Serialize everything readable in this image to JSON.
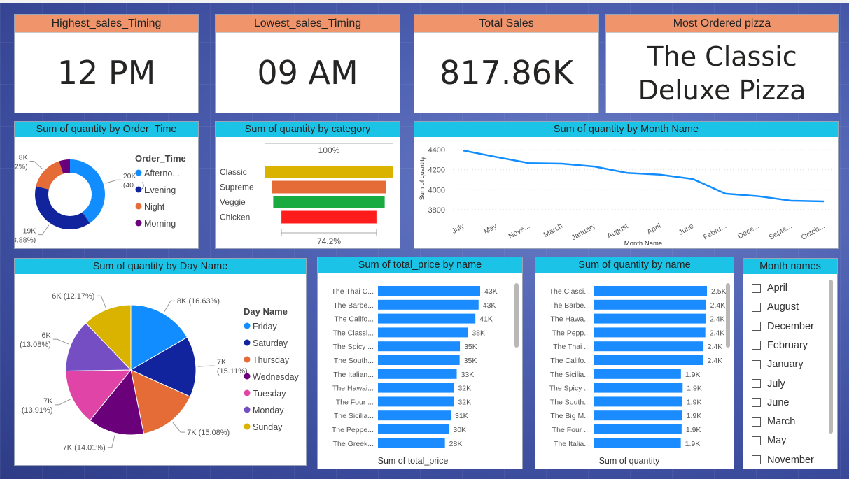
{
  "kpis": [
    {
      "title": "Highest_sales_Timing",
      "value": "12 PM"
    },
    {
      "title": "Lowest_sales_Timing",
      "value": "09 AM"
    },
    {
      "title": "Total Sales",
      "value": "817.86K"
    },
    {
      "title": "Most Ordered pizza",
      "value_line1": "The Classic",
      "value_line2": "Deluxe Pizza"
    }
  ],
  "colors": {
    "card_header": "#f0956b",
    "visual_header": "#1bc3e6",
    "bar_blue": "#1a8cff"
  },
  "chart_data": [
    {
      "type": "pie",
      "id": "order_time",
      "title": "Sum of quantity by Order_Time",
      "donut": true,
      "legend_title": "Order_Time",
      "legend_labels": [
        "Afterno...",
        "Evening",
        "Night",
        "Morning"
      ],
      "labels": [
        "Afternoon",
        "Evening",
        "Night",
        "Morning"
      ],
      "values": [
        20000,
        19000,
        8000,
        2500
      ],
      "colors": [
        "#118dff",
        "#12239e",
        "#e66c37",
        "#6b007b"
      ],
      "data_labels": [
        {
          "l1": "20K",
          "l2": "(40....)"
        },
        {
          "l1": "19K",
          "l2": "(38.88%)"
        },
        {
          "l1": "8K",
          "l2": "(15.2%)"
        },
        {
          "l1": "",
          "l2": ""
        }
      ],
      "legend_position": "right"
    },
    {
      "type": "funnel",
      "id": "category",
      "title": "Sum of quantity by category",
      "categories": [
        "Classic",
        "Supreme",
        "Veggie",
        "Chicken"
      ],
      "values": [
        100,
        89,
        87,
        74.2
      ],
      "colors": [
        "#d9b300",
        "#e66c37",
        "#1aab40",
        "#ff1c1c"
      ],
      "top_label": "100%",
      "bottom_label": "74.2%"
    },
    {
      "type": "line",
      "id": "month",
      "title": "Sum of quantity by Month Name",
      "categories": [
        "July",
        "May",
        "Nove...",
        "March",
        "January",
        "August",
        "April",
        "June",
        "Febru...",
        "Dece...",
        "Septe...",
        "Octob..."
      ],
      "values": [
        4392,
        4328,
        4266,
        4261,
        4232,
        4168,
        4151,
        4107,
        3961,
        3935,
        3890,
        3883
      ],
      "xlabel": "Month Name",
      "ylabel": "Sum of quantity",
      "yticks": [
        3800,
        4000,
        4200,
        4400
      ],
      "ylim": [
        3750,
        4450
      ],
      "grid": true,
      "color": "#118dff"
    },
    {
      "type": "pie",
      "id": "day",
      "title": "Sum of quantity by Day Name",
      "donut": false,
      "legend_title": "Day Name",
      "legend_labels": [
        "Friday",
        "Saturday",
        "Thursday",
        "Wednesday",
        "Tuesday",
        "Monday",
        "Sunday"
      ],
      "labels": [
        "Friday",
        "Saturday",
        "Thursday",
        "Wednesday",
        "Tuesday",
        "Monday",
        "Sunday"
      ],
      "values": [
        16.63,
        15.11,
        15.08,
        14.01,
        13.91,
        13.08,
        12.17
      ],
      "colors": [
        "#118dff",
        "#12239e",
        "#e66c37",
        "#6b007b",
        "#e044a7",
        "#744ec2",
        "#d9b300"
      ],
      "data_labels": [
        {
          "l1": "8K (16.63%)",
          "l2": ""
        },
        {
          "l1": "7K",
          "l2": "(15.11%)"
        },
        {
          "l1": "7K (15.08%)",
          "l2": ""
        },
        {
          "l1": "7K (14.01%)",
          "l2": ""
        },
        {
          "l1": "7K",
          "l2": "(13.91%)"
        },
        {
          "l1": "6K",
          "l2": "(13.08%)"
        },
        {
          "l1": "6K (12.17%)",
          "l2": ""
        }
      ],
      "legend_position": "right"
    },
    {
      "type": "bar",
      "orientation": "horizontal",
      "id": "total_price",
      "title": "Sum of total_price by name",
      "xlabel": "Sum of total_price",
      "categories": [
        "The Thai C...",
        "The Barbe...",
        "The Califo...",
        "The Classi...",
        "The Spicy ...",
        "The South...",
        "The Italian...",
        "The Hawai...",
        "The Four ...",
        "The Sicilia...",
        "The Peppe...",
        "The Greek..."
      ],
      "values": [
        43434,
        42768,
        41410,
        38180,
        34831,
        34706,
        33476,
        32273,
        32265,
        30940,
        30162,
        28454
      ],
      "value_labels": [
        "43K",
        "43K",
        "41K",
        "38K",
        "35K",
        "35K",
        "33K",
        "32K",
        "32K",
        "31K",
        "30K",
        "28K"
      ],
      "color": "#1a8cff"
    },
    {
      "type": "bar",
      "orientation": "horizontal",
      "id": "quantity_name",
      "title": "Sum of quantity by name",
      "xlabel": "Sum of quantity",
      "categories": [
        "The Classi...",
        "The Barbe...",
        "The Hawa...",
        "The Pepp...",
        "The Thai ...",
        "The Califo...",
        "The Sicilia...",
        "The Spicy ...",
        "The South...",
        "The Big M...",
        "The Four ...",
        "The Italia..."
      ],
      "values": [
        2453,
        2432,
        2422,
        2418,
        2371,
        2370,
        1887,
        1924,
        1917,
        1914,
        1902,
        1884
      ],
      "value_labels": [
        "2.5K",
        "2.4K",
        "2.4K",
        "2.4K",
        "2.4K",
        "2.4K",
        "1.9K",
        "1.9K",
        "1.9K",
        "1.9K",
        "1.9K",
        "1.9K"
      ],
      "color": "#1a8cff"
    }
  ],
  "slicer": {
    "title": "Month names",
    "items": [
      "April",
      "August",
      "December",
      "February",
      "January",
      "July",
      "June",
      "March",
      "May",
      "November"
    ]
  }
}
